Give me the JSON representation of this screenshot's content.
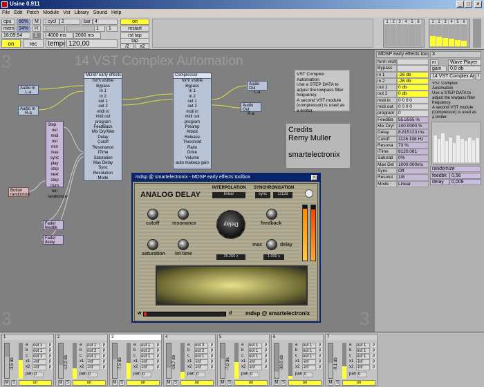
{
  "window": {
    "title": "Usine 0.911"
  },
  "menu": [
    "File",
    "Edit",
    "Patch",
    "Module",
    "Vst",
    "Library",
    "Sound",
    "Help"
  ],
  "top": {
    "cpu_label": "cpu",
    "cpu_val": "66%",
    "mem_label": "mem",
    "mem_val": "34%",
    "time": "16:09:54",
    "m": "M",
    "h": "H",
    "n1": "1",
    "n2": "2",
    "n3": "3",
    "cycl_label": "cycl",
    "cycl_val": "2",
    "bar_label": "bar",
    "bar_val": "4",
    "v1": "1",
    "v2": "1",
    "ms1": "4000 ms",
    "ms2": "2000 ms",
    "on_left": "on",
    "rec": "rec",
    "tempo_label": "tempo",
    "tempo_val": "120,00",
    "on_right": "on",
    "restart": "restart",
    "rsttap": "rst tap",
    "tap": "tap",
    "half": "/2",
    "dbl": "x2",
    "b1": "1",
    "b2": "2",
    "b3": "3"
  },
  "workspace": {
    "num_tl": "3",
    "num_bl": "3",
    "num_br": "3",
    "heading": "14 VST Complex Automation",
    "note": "VST Complex Automation\nUse a STEP DATA to\nadjust the lowpass filter\nfrequency.\nA second VST module\n(compressor) is used as\na limiter.",
    "credits": "Credits\nRemy Muller\n\nsmartelectronix",
    "audioin1": "Audio In",
    "audioin1_ch": "L-a",
    "audioin2": "Audio In",
    "audioin2_ch": "R-a",
    "audioout1": "Audio Out",
    "audioout1_ch": "L-a",
    "audioout2": "Audio Out",
    "audioout2_ch": "R-a",
    "step_title": "Step",
    "step_items": [
      "out",
      "midi out",
      "min",
      "max",
      "sync",
      "play",
      "stop",
      "next step",
      "num",
      "len",
      "randomize"
    ],
    "button_title": "Button",
    "button_sub": "randomize",
    "fader1": "Fader",
    "fader1_sub": "feedbk",
    "fader2": "Fader",
    "fader2_sub": "delay",
    "mdsp_title": "MDSP early effects",
    "mdsp_items": [
      "form visible",
      "Bypass",
      "in 1",
      "in 2",
      "out 1",
      "out 2",
      "midi in",
      "midi out",
      "program",
      "FeedBack",
      "Mix Dry/Wet",
      "Delay",
      "Cutoff",
      "Resonance",
      "ITime",
      "Saturation",
      "Max Delay",
      "Sync",
      "Resolution",
      "Mode"
    ],
    "comp_title": "Compressor",
    "comp_items": [
      "form visible",
      "Bypass",
      "in 1",
      "in 2",
      "out 1",
      "out 2",
      "midi in",
      "midi out",
      "program",
      "Preamp",
      "Attack",
      "Release",
      "Threshold",
      "Ratio",
      "Drive",
      "Volume",
      "auto makeup gain"
    ]
  },
  "vst": {
    "title": "mdsp @ smartelectronix - MDSP early effects toolbox",
    "name": "ANALOG DELAY",
    "interp_label": "INTERPOLATION",
    "interp_val": "linear",
    "sync_label": "SYNCHRONISATION",
    "sync_val": "sync",
    "sync_ratio": "1/128",
    "k_cutoff": "cutoff",
    "k_res": "resonance",
    "k_feedback": "feedback",
    "k_sat": "saturation",
    "k_int": "Int time",
    "k_max": "max",
    "k_delay": "delay",
    "big": "Delay",
    "val1": "25.260 z",
    "val2": "1.000 s",
    "w": "w",
    "d": "d",
    "brand": "mdsp @ smartelectronix"
  },
  "right": {
    "top_nums": [
      "1",
      "2",
      "3",
      "4",
      "5",
      "6"
    ],
    "top_nums2": [
      "1",
      "2",
      "3",
      "4",
      "5",
      "6"
    ],
    "inspector_title": "MDSP early effects toolb",
    "three": "3",
    "rows": [
      [
        "form visible",
        ""
      ],
      [
        "Bypass",
        ""
      ],
      [
        "in 1",
        "-26 db"
      ],
      [
        "in 2",
        "-26 db"
      ],
      [
        "out 1",
        "0 db"
      ],
      [
        "out 2",
        "0 db"
      ],
      [
        "midi in",
        "0  0  0  0"
      ],
      [
        "midi out",
        "0  0  0  0"
      ],
      [
        "program",
        "0"
      ],
      [
        "FeedBa",
        "55.5555 %"
      ],
      [
        "Mix Dry/",
        "100.0000 %"
      ],
      [
        "Delay",
        "8.815123 ms"
      ],
      [
        "Cutoff",
        "1128.198 Hz"
      ],
      [
        "Resona",
        "73 %"
      ],
      [
        "ITime",
        "8120.081"
      ],
      [
        "Saturati",
        "0%"
      ],
      [
        "Max Del",
        "1000.000ms"
      ],
      [
        "Sync",
        "Off"
      ],
      [
        "Resolut",
        "1/8"
      ],
      [
        "Mode",
        "Linear"
      ]
    ],
    "in_label": "in",
    "wave": "Wave Player",
    "gain_label": "gain",
    "gain_val": "0,0 db",
    "vst_note_title": "14 VST Complex Autom",
    "f": "f",
    "vst_note": "VST Complex Automation\nUse a STEP DATA to\nadjust the lowpass filter\nfrequency.\nA second VST module\n(compressor) is used as\na limiter.",
    "randomize": "randomize",
    "feedbk": "feedbk",
    "feedbk_val": "0,56",
    "delay": "delay",
    "delay_val": "0,009"
  },
  "strips": [
    {
      "n": "1",
      "db": "-3,5 db",
      "o1": "out 1",
      "o2": "out 1",
      "o3": "out 1"
    },
    {
      "n": "2",
      "db": "-12,0 db",
      "o1": "out 1",
      "o2": "out 2",
      "o3": "out 1"
    },
    {
      "n": "3",
      "db": "-7,5 db",
      "o1": "out 1",
      "o2": "out 2",
      "o3": "out 1"
    },
    {
      "n": "4",
      "db": "-18,7 db",
      "o1": "out 3",
      "o2": "out 2",
      "o3": "out 1"
    },
    {
      "n": "5",
      "db": "-7,0 db",
      "o1": "out 1",
      "o2": "out 1",
      "o3": "out 1"
    },
    {
      "n": "6",
      "db": "-30,0 db",
      "o1": "out 1",
      "o2": "out 1",
      "o3": "out 1"
    },
    {
      "n": "7",
      "db": "-9,1 db",
      "o1": "out 1",
      "o2": "out 1",
      "o3": "out 1"
    }
  ],
  "strip_common": {
    "a": "a",
    "b": "b",
    "c": "c",
    "x1": "x1",
    "x2": "x2",
    "inf": "-inf",
    "p": "p",
    "pan": "pan",
    "pan_val": "0",
    "m": "M",
    "s": "S",
    "on": "on"
  }
}
